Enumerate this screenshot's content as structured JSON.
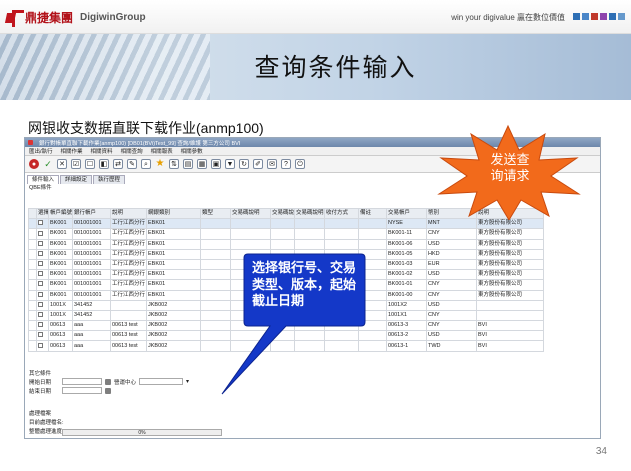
{
  "header": {
    "logo_cn": "鼎捷集團",
    "logo_en": "DigiwinGroup",
    "slogan": "win your digivalue 贏在數位價值",
    "square_colors": [
      "#2e6fb5",
      "#4a86c8",
      "#c0392b",
      "#8e44ad",
      "#2e6fb5",
      "#6699cc"
    ]
  },
  "banner": {
    "title": "查询条件输入"
  },
  "slide": {
    "subtitle": "网银收支数据直联下载作业(anmp100)",
    "page_number": "34"
  },
  "window": {
    "title": "銀行對帳單直聯下載作業(anmp100)  [DB01(BVi)Test_99]  查詢/維護 第三方公司 BVI",
    "menus": [
      "匯出/執行",
      "相關作業",
      "相關資料",
      "相關查詢",
      "相關報表",
      "相關參數"
    ],
    "toolbar_icons": [
      "exit-icon",
      "accept-icon",
      "cancel-icon",
      "select-all-icon",
      "checkbox-icon",
      "toggle-icon",
      "shuffle-icon",
      "attach-icon",
      "search-icon",
      "favorite-icon",
      "sort-icon",
      "print-icon",
      "export-icon",
      "calc-icon",
      "filter-icon",
      "refresh-icon",
      "clear-icon",
      "chat-icon",
      "help-icon",
      "exit-app-icon"
    ],
    "tabs": [
      "條件輸入",
      "詳細設定",
      "執行歷程"
    ],
    "query_group_label": "QBE條件",
    "columns": [
      "",
      "選擇",
      "帳戶編號",
      "銀行帳戶",
      "說明",
      "網銀類別",
      "類型",
      "交易碼說明",
      "交易碼說明",
      "交易碼說明",
      "收付方式",
      "備註",
      "交易帳戶",
      "幣別",
      "說明"
    ],
    "rows": [
      {
        "acct": "BK001",
        "bank_acct": "001001001",
        "desc": "工行江西分行",
        "ebank": "EBK01",
        "trade_acct": "NYSE",
        "currency": "MNT",
        "company": "東方股份有限公司",
        "selected": true
      },
      {
        "acct": "BK001",
        "bank_acct": "001001001",
        "desc": "工行江西分行",
        "ebank": "EBK01",
        "trade_acct": "BK001-11",
        "currency": "CNY",
        "company": "東方股份有限公司",
        "selected": false
      },
      {
        "acct": "BK001",
        "bank_acct": "001001001",
        "desc": "工行江西分行",
        "ebank": "EBK01",
        "trade_acct": "BK001-06",
        "currency": "USD",
        "company": "東方股份有限公司",
        "selected": false
      },
      {
        "acct": "BK001",
        "bank_acct": "001001001",
        "desc": "工行江西分行",
        "ebank": "EBK01",
        "trade_acct": "BK001-05",
        "currency": "HKD",
        "company": "東方股份有限公司",
        "selected": false
      },
      {
        "acct": "BK001",
        "bank_acct": "001001001",
        "desc": "工行江西分行",
        "ebank": "EBK01",
        "trade_acct": "BK001-03",
        "currency": "EUR",
        "company": "東方股份有限公司",
        "selected": false
      },
      {
        "acct": "BK001",
        "bank_acct": "001001001",
        "desc": "工行江西分行",
        "ebank": "EBK01",
        "trade_acct": "BK001-02",
        "currency": "USD",
        "company": "東方股份有限公司",
        "selected": false
      },
      {
        "acct": "BK001",
        "bank_acct": "001001001",
        "desc": "工行江西分行",
        "ebank": "EBK01",
        "trade_acct": "BK001-01",
        "currency": "CNY",
        "company": "東方股份有限公司",
        "selected": false
      },
      {
        "acct": "BK001",
        "bank_acct": "001001001",
        "desc": "工行江西分行",
        "ebank": "EBK01",
        "trade_acct": "BK001-00",
        "currency": "CNY",
        "company": "東方股份有限公司",
        "selected": false
      },
      {
        "acct": "1001X",
        "bank_acct": "341452",
        "desc": "",
        "ebank": "JKB002",
        "trade_acct": "1001X2",
        "currency": "USD",
        "company": "",
        "selected": false
      },
      {
        "acct": "1001X",
        "bank_acct": "341452",
        "desc": "",
        "ebank": "JKB002",
        "trade_acct": "1001X1",
        "currency": "CNY",
        "company": "",
        "selected": false
      },
      {
        "acct": "00613",
        "bank_acct": "aaa",
        "desc": "00613 test",
        "ebank": "JKB002",
        "trade_acct": "00613-3",
        "currency": "CNY",
        "company": "BVI",
        "selected": false
      },
      {
        "acct": "00613",
        "bank_acct": "aaa",
        "desc": "00613 test",
        "ebank": "JKB002",
        "trade_acct": "00613-2",
        "currency": "USD",
        "company": "BVI",
        "selected": false
      },
      {
        "acct": "00613",
        "bank_acct": "aaa",
        "desc": "00613 test",
        "ebank": "JKB002",
        "trade_acct": "00613-1",
        "currency": "TWD",
        "company": "BVI",
        "selected": false
      }
    ],
    "filters": {
      "group_label": "其它條件",
      "start_date_label": "開始日期",
      "end_date_label": "結束日期",
      "center_label": "營運中心"
    },
    "status": {
      "group_label": "處理檔案",
      "current_label": "目前處理檔名:",
      "progress_label": "整體處理進度",
      "progress_value": "0%"
    }
  },
  "annotations": {
    "starburst_text": "发送查询请求",
    "callout_text": "选择银行号、交易类型、版本，起始 截止日期",
    "starburst_color": "#f26a1b",
    "callout_color": "#1438c8"
  }
}
